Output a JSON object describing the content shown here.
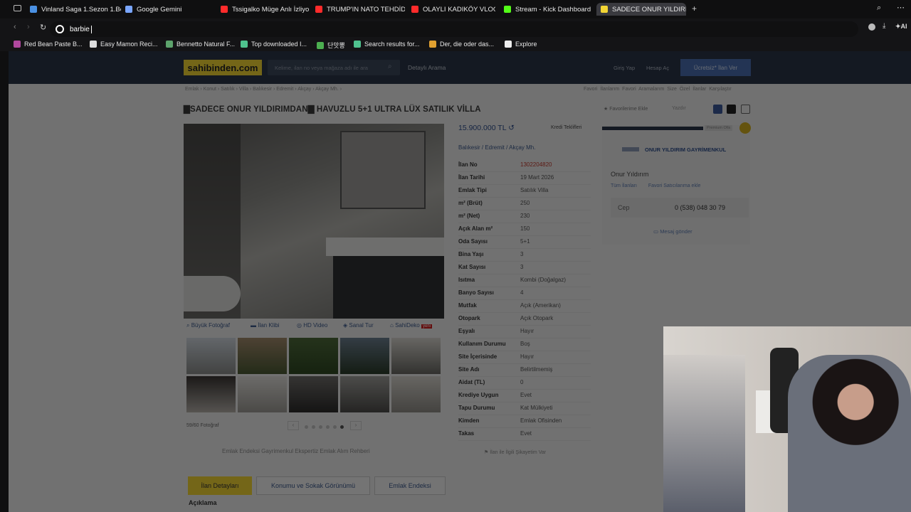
{
  "tabs": [
    {
      "label": "Vinland Saga 1.Sezon 1.Bö",
      "color": "#4a90e2"
    },
    {
      "label": "Google Gemini",
      "color": "#7aa6ff"
    },
    {
      "label": "Tssigalko Müge Anlı İzliyo",
      "color": "#ff2b2b"
    },
    {
      "label": "TRUMP'IN NATO TEHDİDİ",
      "color": "#ff2b2b"
    },
    {
      "label": "OLAYLI KADIKÖY VLOG H",
      "color": "#ff2b2b"
    },
    {
      "label": "Stream - Kick Dashboard",
      "color": "#53fc18"
    },
    {
      "label": "SADECE ONUR YILDIRI",
      "color": "#f2d534",
      "active": true
    }
  ],
  "address": {
    "value": "barbie"
  },
  "bookmarks": [
    "Red Bean Paste B...",
    "Easy Mamon Reci...",
    "Bennetto Natural F...",
    "Top downloaded I...",
    "단맛뽕",
    "Search results for...",
    "Der, die oder das...",
    "Explore"
  ],
  "site": {
    "logo": "sahibinden.com",
    "search_placeholder": "Kelime, ilan no veya mağaza adı ile ara",
    "detailed_search": "Detaylı Arama",
    "login": "Giriş Yap",
    "signup": "Hesap Aç",
    "post_ad": "Ücretsiz* İlan Ver",
    "breadcrumb": "Emlak  ›  Konut  ›  Satılık  ›  Villa  ›  Balıkesir  ›  Edremit  ›  Akçay  ›  Akçay Mh.  ›",
    "top_links": "Favori İlanlarım   Favori Aramalarım   Size Özel İlanlar   Karşılaştır"
  },
  "listing": {
    "title": "▇SADECE ONUR YILDIRIMDAN▇ HAVUZLU 5+1 ULTRA LÜX SATILIK VİLLA",
    "fav_add": "★ Favorilerime Ekle",
    "print": "Yazdır",
    "price": "15.900.000 TL",
    "credit": "Kredi Teklifleri",
    "location": "Balıkesir  /  Edremit  /  Akçay Mh.",
    "photo_tabs": [
      "Büyük Fotoğraf",
      "İlan Klibi",
      "HD Video",
      "Sanal Tur",
      "SahiDeko"
    ],
    "sahideko_badge": "yeni",
    "photo_count": "59/60 Fotoğraf",
    "details": [
      {
        "k": "İlan No",
        "v": "1302204820",
        "red": true
      },
      {
        "k": "İlan Tarihi",
        "v": "19 Mart 2026"
      },
      {
        "k": "Emlak Tipi",
        "v": "Satılık Villa"
      },
      {
        "k": "m² (Brüt)",
        "v": "250"
      },
      {
        "k": "m² (Net)",
        "v": "230"
      },
      {
        "k": "Açık Alan m²",
        "v": "150"
      },
      {
        "k": "Oda Sayısı",
        "v": "5+1"
      },
      {
        "k": "Bina Yaşı",
        "v": "3"
      },
      {
        "k": "Kat Sayısı",
        "v": "3"
      },
      {
        "k": "Isıtma",
        "v": "Kombi (Doğalgaz)"
      },
      {
        "k": "Banyo Sayısı",
        "v": "4"
      },
      {
        "k": "Mutfak",
        "v": "Açık (Amerikan)"
      },
      {
        "k": "Otopark",
        "v": "Açık Otopark"
      },
      {
        "k": "Eşyalı",
        "v": "Hayır"
      },
      {
        "k": "Kullanım Durumu",
        "v": "Boş"
      },
      {
        "k": "Site İçerisinde",
        "v": "Hayır"
      },
      {
        "k": "Site Adı",
        "v": "Belirtilmemiş"
      },
      {
        "k": "Aidat (TL)",
        "v": "0"
      },
      {
        "k": "Krediye Uygun",
        "v": "Evet"
      },
      {
        "k": "Tapu Durumu",
        "v": "Kat Mülkiyeti"
      },
      {
        "k": "Kimden",
        "v": "Emlak Ofisinden"
      },
      {
        "k": "Takas",
        "v": "Evet"
      }
    ]
  },
  "seller": {
    "premium": "Premium Ofis",
    "agency": "ONUR YILDIRIM GAYRİMENKUL",
    "agent": "Onur Yıldırım",
    "all_listings": "Tüm İlanları",
    "fav_seller": "Favori Satıcılarıma ekle",
    "phone_label": "Cep",
    "phone": "0 (538) 048 30 79",
    "message": "Mesaj gönder"
  },
  "bottom": {
    "links": "Emlak Endeksi      Gayrimenkul Ekspertiz      Emlak Alım Rehberi",
    "report": "İlan ile İlgili Şikayetim Var",
    "tabs": [
      "İlan Detayları",
      "Konumu ve Sokak Görünümü",
      "Emlak Endeksi"
    ],
    "desc_heading": "Açıklama"
  },
  "colors": {
    "brand_yellow": "#f2d534",
    "header_navy": "#2b3648",
    "link_blue": "#3d5a8c"
  }
}
